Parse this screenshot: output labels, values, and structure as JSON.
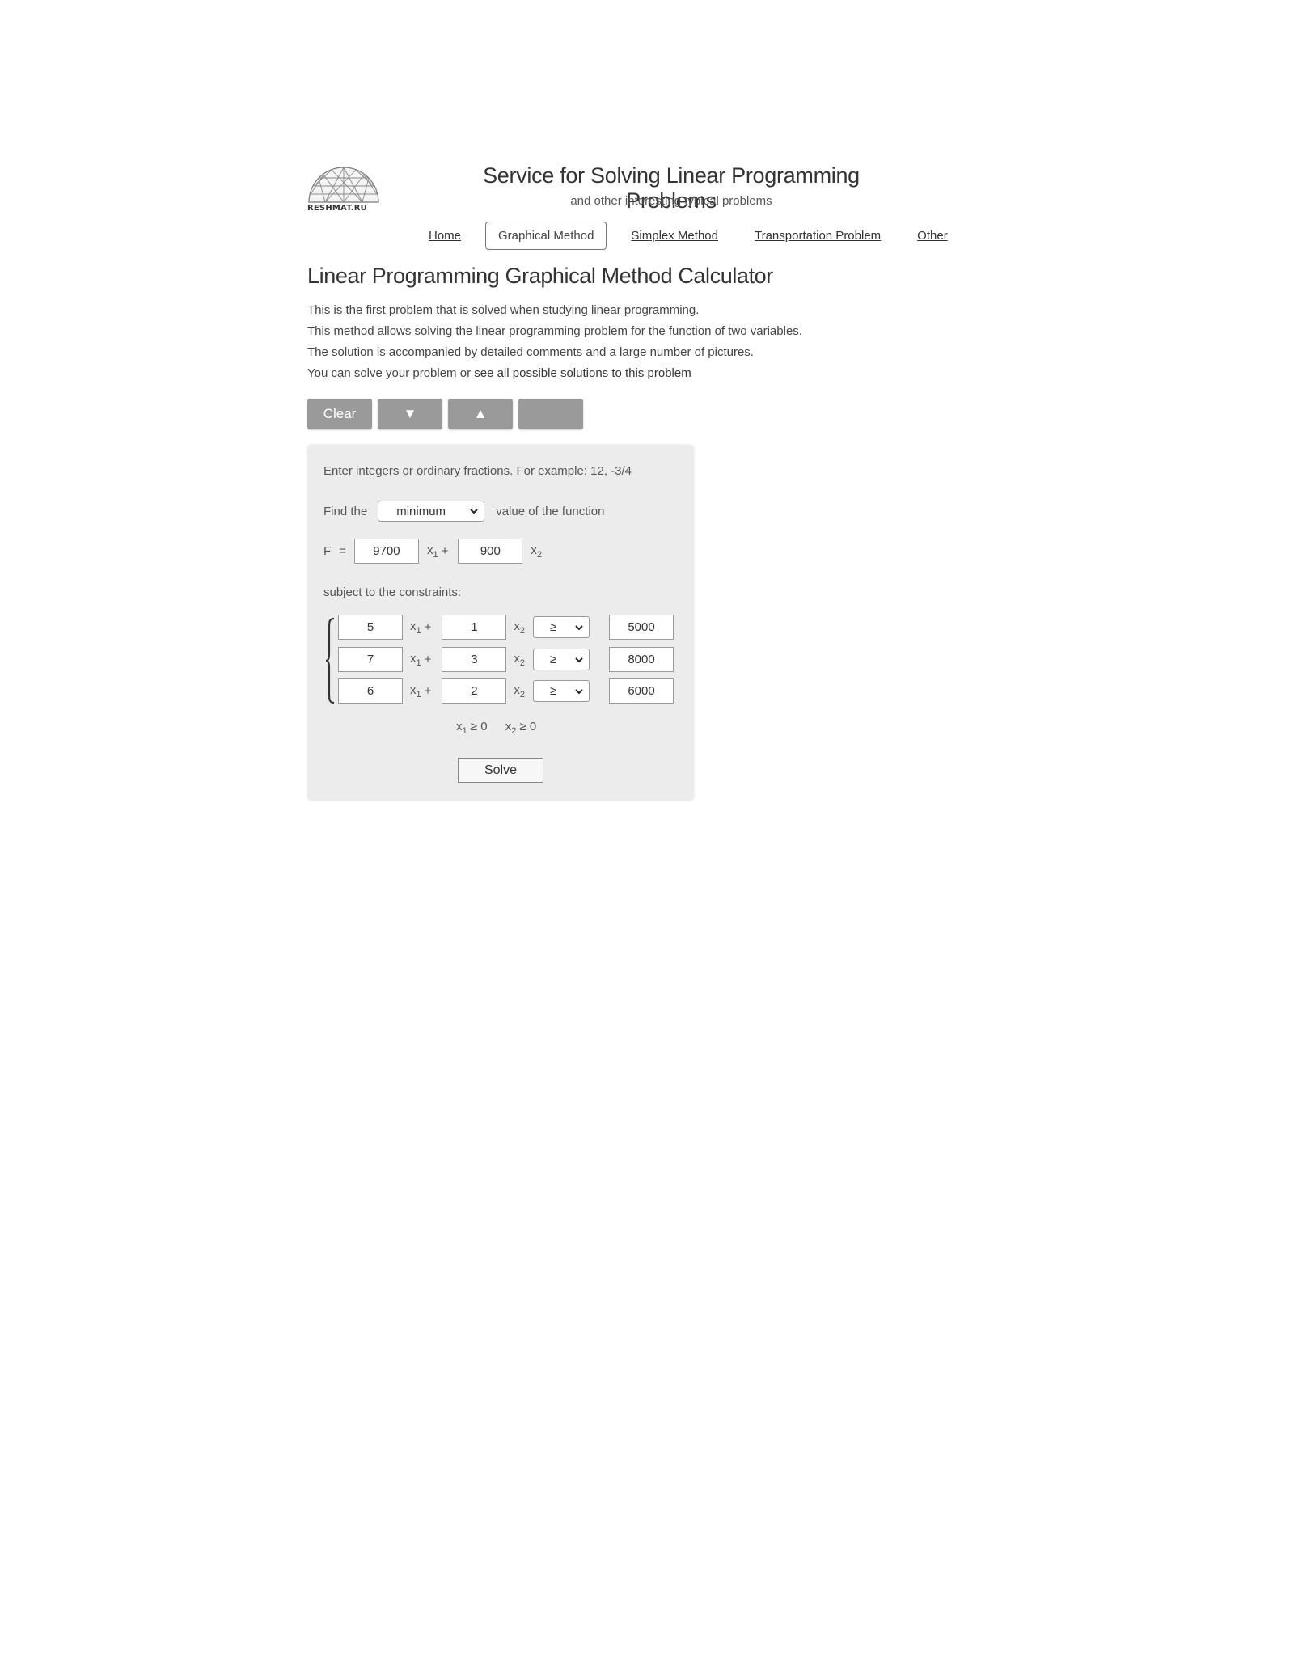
{
  "header": {
    "logo_text": "RESHMAT.RU",
    "title": "Service for Solving Linear Programming Problems",
    "subtitle": "and other interesting typical problems"
  },
  "nav": {
    "items": [
      {
        "label": "Home"
      },
      {
        "label": "Graphical Method"
      },
      {
        "label": "Simplex Method"
      },
      {
        "label": "Transportation Problem"
      },
      {
        "label": "Other"
      }
    ]
  },
  "main": {
    "heading": "Linear Programming Graphical Method Calculator",
    "intro_lines": [
      "This is the first problem that is solved when studying linear programming.",
      "This method allows solving the linear programming problem for the function of two variables.",
      "The solution is accompanied by detailed comments and a large number of pictures.",
      "You can solve your problem or"
    ],
    "intro_link": "see all possible solutions to this problem"
  },
  "toolbar": {
    "clear_label": "Clear",
    "down_label": "▼",
    "up_label": "▲",
    "extra_label": ""
  },
  "form": {
    "hint": "Enter integers or ordinary fractions. For example: 12, -3/4",
    "find_prefix": "Find the",
    "objective_type": "minimum",
    "find_suffix": "value of the function",
    "f_label": "F",
    "equals": "=",
    "f_coef1": "9700",
    "f_coef2": "900",
    "var_x": "x",
    "sub1": "1",
    "sub2": "2",
    "plus": "+",
    "subject_label": "subject to the constraints:",
    "constraints": [
      {
        "a": "5",
        "b": "1",
        "sign": "≥",
        "rhs": "5000"
      },
      {
        "a": "7",
        "b": "3",
        "sign": "≥",
        "rhs": "8000"
      },
      {
        "a": "6",
        "b": "2",
        "sign": "≥",
        "rhs": "6000"
      }
    ],
    "nonneg_rel": "≥ 0",
    "solve_label": "Solve"
  }
}
